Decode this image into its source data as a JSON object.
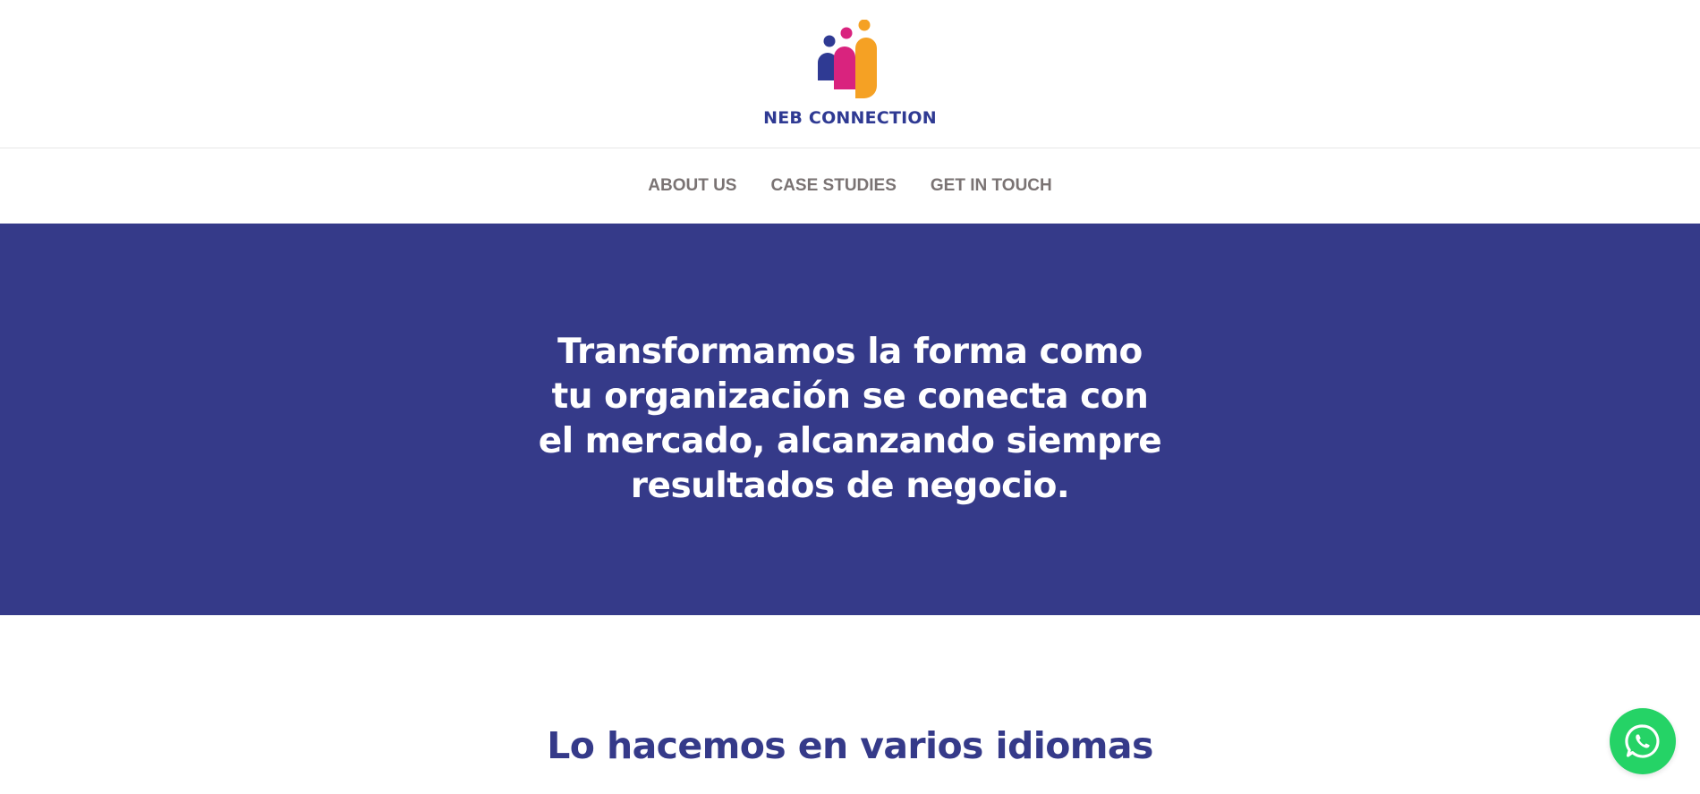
{
  "brand": {
    "name": "NEB CONNECTION",
    "colors": {
      "navy": "#2f3a93",
      "magenta": "#d9237e",
      "orange": "#f5a124",
      "hero_bg": "#353a89",
      "whatsapp_green": "#25d366"
    }
  },
  "nav": {
    "items": [
      {
        "label": "ABOUT US"
      },
      {
        "label": "CASE STUDIES"
      },
      {
        "label": "GET IN TOUCH"
      }
    ]
  },
  "hero": {
    "headline": "Transformamos la forma como tu organización se conecta con el mercado, alcanzando siempre resultados de negocio."
  },
  "section": {
    "title": "Lo hacemos en varios idiomas"
  },
  "floating": {
    "whatsapp_icon": "whatsapp-icon"
  }
}
